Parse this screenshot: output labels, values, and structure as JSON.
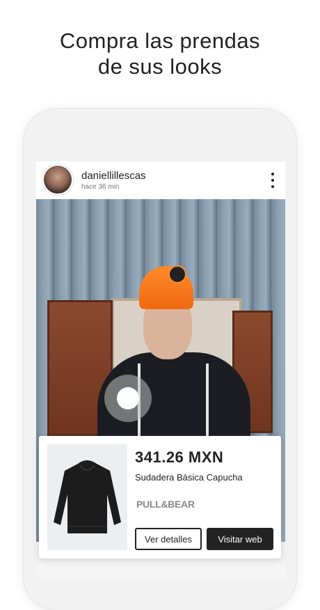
{
  "headline": {
    "line1": "Compra las prendas",
    "line2": "de sus looks"
  },
  "post": {
    "username": "daniellillescas",
    "time_ago": "hace 36 min",
    "menu_icon": "more-vertical-icon"
  },
  "product": {
    "price": "341.26 MXN",
    "name": "Sudadera Básica Capucha",
    "brand": "PULL&BEAR",
    "details_button": "Ver detalles",
    "visit_button": "Visitar web"
  },
  "colors": {
    "text": "#222222",
    "beanie": "#f06a10",
    "button_dark": "#222222"
  }
}
